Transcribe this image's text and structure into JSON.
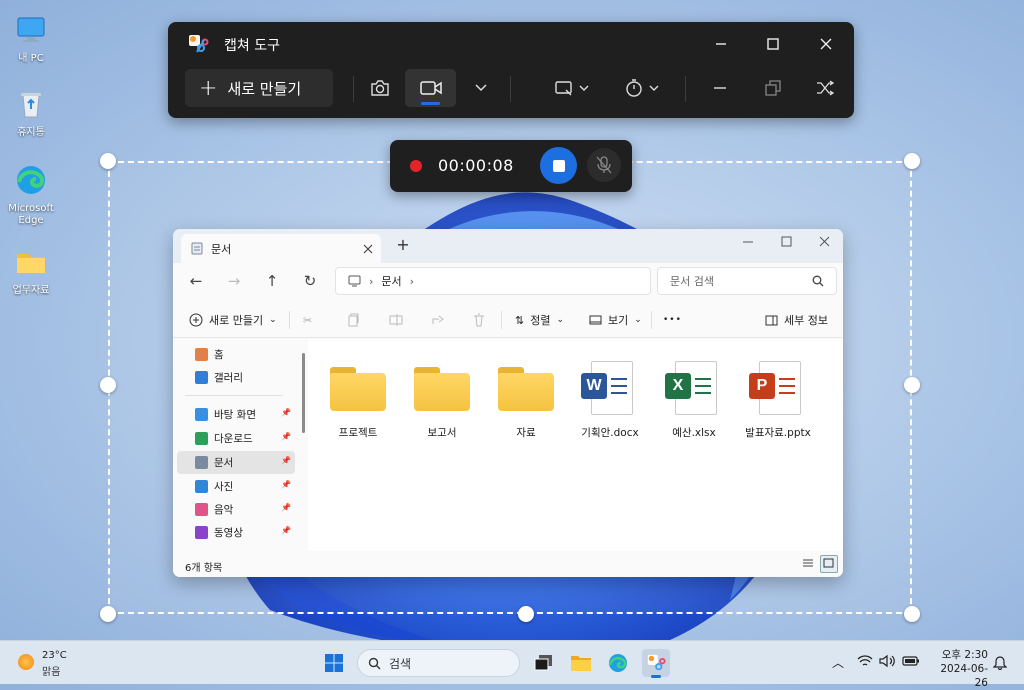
{
  "colors": {
    "accent": "#1d6fe0",
    "record": "#e5232a",
    "toolbar_bg": "#1f1f1f"
  },
  "desktop": {
    "icons": [
      {
        "label": "내 PC",
        "icon": "monitor-icon"
      },
      {
        "label": "휴지통",
        "icon": "recycle-bin-icon"
      },
      {
        "label": "Microsoft Edge",
        "icon": "edge-icon"
      },
      {
        "label": "업무자료",
        "icon": "folder-icon"
      }
    ]
  },
  "capture_tool": {
    "title": "캡쳐 도구",
    "new_button_label": "새로 만들기",
    "buttons": [
      "camera-icon",
      "video-icon",
      "chevron-down-icon",
      "screen-region-icon",
      "timer-icon",
      "minimize-icon",
      "restore-icon",
      "close-icon"
    ]
  },
  "recording": {
    "elapsed": "00:00:08"
  },
  "explorer": {
    "tab_title": "문서",
    "breadcrumb": "문서",
    "search_placeholder": "문서 검색",
    "commands": {
      "new": "새로 만들기",
      "sort": "정렬",
      "view": "보기",
      "more": "•••",
      "details": "세부 정보"
    },
    "nav": [
      {
        "label": "홈",
        "icon": "home-icon",
        "color": "#e0804a",
        "pinned": false,
        "selected": false
      },
      {
        "label": "갤러리",
        "icon": "gallery-icon",
        "color": "#2f7fd6",
        "pinned": false,
        "selected": false
      },
      {
        "label": "바탕 화면",
        "icon": "desktop-icon",
        "color": "#3a8fe0",
        "pinned": true,
        "selected": false
      },
      {
        "label": "다운로드",
        "icon": "download-icon",
        "color": "#2f9e5a",
        "pinned": true,
        "selected": false
      },
      {
        "label": "문서",
        "icon": "document-icon",
        "color": "#7b8aa0",
        "pinned": true,
        "selected": true
      },
      {
        "label": "사진",
        "icon": "pictures-icon",
        "color": "#3585d6",
        "pinned": true,
        "selected": false
      },
      {
        "label": "음악",
        "icon": "music-icon",
        "color": "#e0548a",
        "pinned": true,
        "selected": false
      },
      {
        "label": "동영상",
        "icon": "video-icon",
        "color": "#8a43c9",
        "pinned": true,
        "selected": false
      }
    ],
    "files": [
      {
        "name": "프로젝트",
        "type": "folder"
      },
      {
        "name": "보고서",
        "type": "folder"
      },
      {
        "name": "자료",
        "type": "folder"
      },
      {
        "name": "기획안.docx",
        "type": "word",
        "color": "#2b579a",
        "letter": "W"
      },
      {
        "name": "예산.xlsx",
        "type": "excel",
        "color": "#217346",
        "letter": "X"
      },
      {
        "name": "발표자료.pptx",
        "type": "powerpoint",
        "color": "#c43e1c",
        "letter": "P"
      }
    ],
    "status": "6개 항목"
  },
  "taskbar": {
    "weather_temp": "23°C",
    "weather_desc": "맑음",
    "search_label": "검색",
    "time": "오후 2:30",
    "date": "2024-06-26"
  }
}
